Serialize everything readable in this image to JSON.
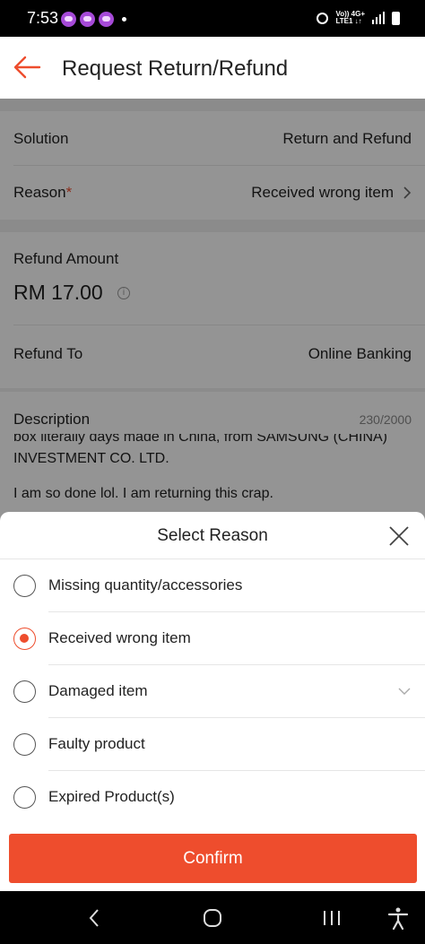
{
  "status_bar": {
    "time": "7:53",
    "network_top": "Vo)) 4G+",
    "network_bottom": "LTE1 ↓↑",
    "icons": [
      "notification-app-icon",
      "alarm-icon",
      "signal-icon",
      "battery-icon"
    ]
  },
  "header": {
    "title": "Request Return/Refund",
    "back_icon": "arrow-left-icon",
    "accent_color": "#ee4d2d"
  },
  "form": {
    "solution_label": "Solution",
    "solution_value": "Return and Refund",
    "reason_label": "Reason",
    "reason_required": "*",
    "reason_value": "Received wrong item",
    "refund_amount_label": "Refund Amount",
    "refund_amount_value": "RM 17.00",
    "refund_to_label": "Refund To",
    "refund_to_value": "Online Banking",
    "description_label": "Description",
    "description_count": "230/2000",
    "description_line1": "box literally days made in China, from SAMSUNG (CHINA)",
    "description_line2": "INVESTMENT CO. LTD.",
    "description_line3": "I am so done lol. I am returning this crap."
  },
  "sheet": {
    "title": "Select Reason",
    "options": [
      {
        "label": "Missing quantity/accessories",
        "selected": false
      },
      {
        "label": "Received wrong item",
        "selected": true
      },
      {
        "label": "Damaged item",
        "selected": false,
        "expandable": true
      },
      {
        "label": "Faulty product",
        "selected": false
      },
      {
        "label": "Expired Product(s)",
        "selected": false
      }
    ],
    "confirm_label": "Confirm"
  },
  "nav_bar": {
    "icons": [
      "back-nav-icon",
      "home-nav-icon",
      "recents-nav-icon",
      "accessibility-icon"
    ]
  }
}
